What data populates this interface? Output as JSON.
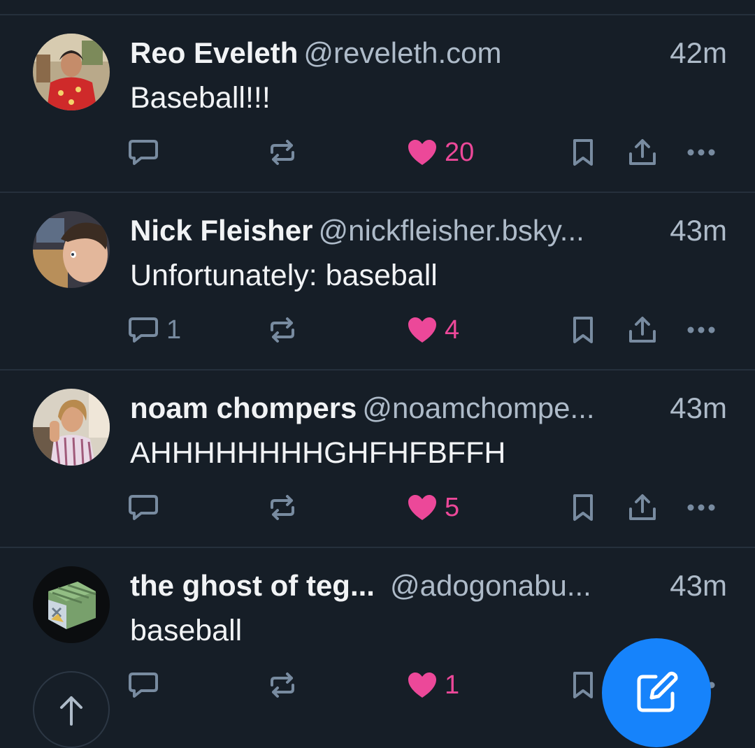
{
  "colors": {
    "background": "#161e27",
    "divider": "#25303c",
    "text_primary": "#f1f3f5",
    "text_secondary": "#aebbc9",
    "icon_muted": "#788ba0",
    "like_pink": "#ec4899",
    "compose_blue": "#1683fb"
  },
  "posts": [
    {
      "display_name": "Reo Eveleth",
      "handle": "@reveleth.com",
      "time": "42m",
      "text": "Baseball!!!",
      "reply_count": "",
      "like_count": "20",
      "avatar_icon": "person-red-shirt-avatar"
    },
    {
      "display_name": "Nick Fleisher",
      "handle": "@nickfleisher.bsky...",
      "time": "43m",
      "text": "Unfortunately: baseball",
      "reply_count": "1",
      "like_count": "4",
      "avatar_icon": "person-profile-avatar"
    },
    {
      "display_name": "noam chompers",
      "handle": "@noamchompe...",
      "time": "43m",
      "text": "AHHHHHHHHGHFHFBFFH",
      "reply_count": "",
      "like_count": "5",
      "avatar_icon": "person-striped-shirt-avatar"
    },
    {
      "display_name": "the ghost of teg...",
      "handle": "@adogonabu...",
      "time": "43m",
      "text": "baseball",
      "reply_count": "",
      "like_count": "1",
      "avatar_icon": "pokemon-avatar"
    }
  ],
  "icons": {
    "reply": "reply-icon",
    "repost": "repost-icon",
    "like": "heart-icon",
    "bookmark": "bookmark-icon",
    "share": "share-icon",
    "more": "more-icon",
    "scroll_top": "arrow-up-icon",
    "compose": "compose-icon"
  }
}
